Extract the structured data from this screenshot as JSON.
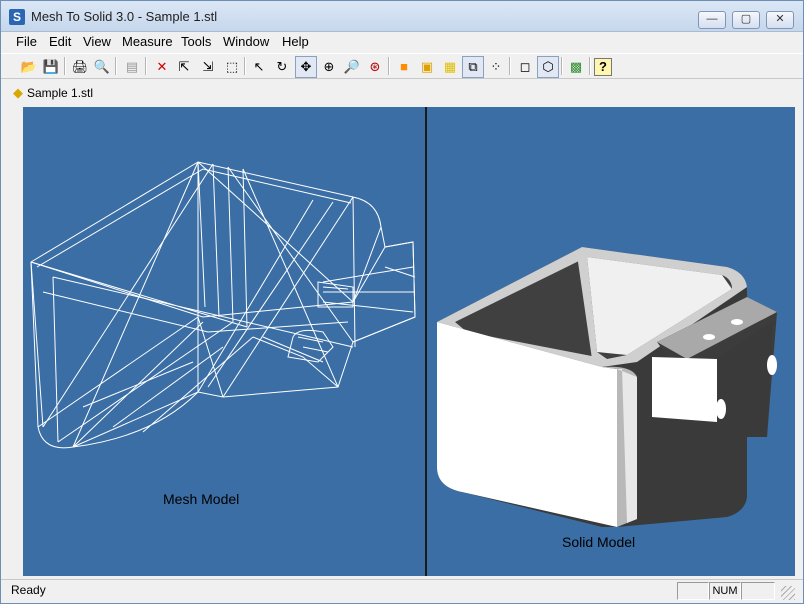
{
  "window": {
    "title": "Mesh To Solid 3.0 - Sample 1.stl",
    "app_icon_letter": "S"
  },
  "window_buttons": {
    "minimize": "—",
    "maximize": "▢",
    "close": "✕"
  },
  "menu": [
    "File",
    "Edit",
    "View",
    "Measure",
    "Tools",
    "Window",
    "Help"
  ],
  "toolbar": [
    {
      "name": "open-icon",
      "glyph": "📂"
    },
    {
      "name": "save-icon",
      "glyph": "💾"
    },
    {
      "name": "print-icon",
      "glyph": "🖨"
    },
    {
      "name": "print-preview-icon",
      "glyph": "🔍"
    },
    {
      "name": "properties-icon",
      "glyph": "▤"
    },
    {
      "name": "delete-icon",
      "glyph": "✕"
    },
    {
      "name": "select-icon",
      "glyph": "⇱"
    },
    {
      "name": "select-add-icon",
      "glyph": "⇲"
    },
    {
      "name": "select-window-icon",
      "glyph": "⬚"
    },
    {
      "name": "pointer-icon",
      "glyph": "↖"
    },
    {
      "name": "rotate-icon",
      "glyph": "↻"
    },
    {
      "name": "pan-icon",
      "glyph": "✥"
    },
    {
      "name": "zoom-in-icon",
      "glyph": "⊕"
    },
    {
      "name": "zoom-icon",
      "glyph": "🔎"
    },
    {
      "name": "zoom-all-icon",
      "glyph": "⊛"
    },
    {
      "name": "shaded-icon",
      "glyph": "■"
    },
    {
      "name": "shaded-edges-icon",
      "glyph": "▣"
    },
    {
      "name": "flat-icon",
      "glyph": "▦"
    },
    {
      "name": "wireframe-icon",
      "glyph": "⧉"
    },
    {
      "name": "points-icon",
      "glyph": "⁘"
    },
    {
      "name": "box-view-icon",
      "glyph": "◻"
    },
    {
      "name": "iso-view-icon",
      "glyph": "⬡"
    },
    {
      "name": "screenshot-icon",
      "glyph": "▩"
    },
    {
      "name": "help-icon",
      "glyph": "?"
    }
  ],
  "document": {
    "tab_label": "Sample 1.stl"
  },
  "viewports": {
    "left_caption": "Mesh Model",
    "right_caption": "Solid Model"
  },
  "status": {
    "text": "Ready",
    "indicator_num": "NUM",
    "indicator_blank1": "",
    "indicator_blank2": ""
  },
  "colors": {
    "viewport_bg": "#3a6ea5",
    "mesh_line": "#ffffff",
    "solid_light": "#f2f2f2",
    "solid_dark": "#3a3a3a"
  }
}
